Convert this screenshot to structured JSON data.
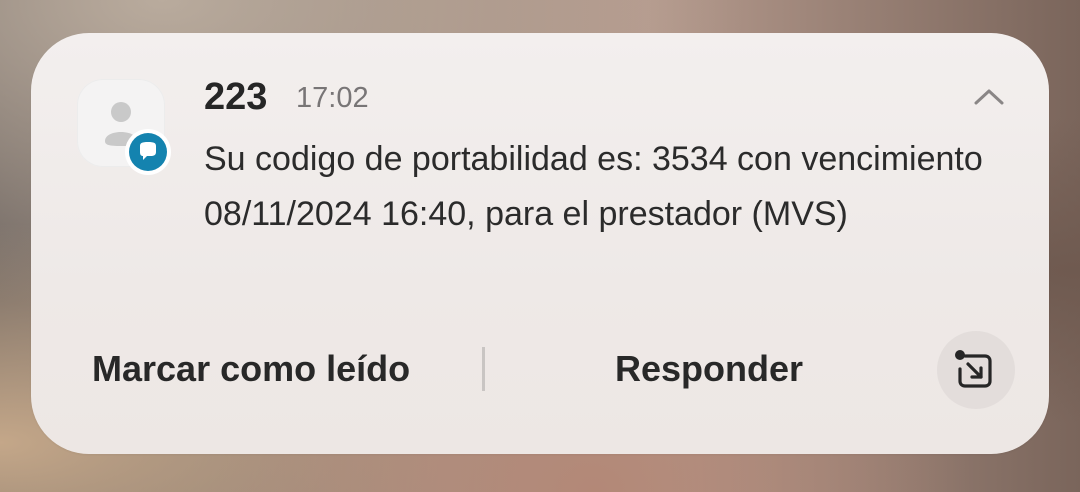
{
  "notification": {
    "sender": "223",
    "time": "17:02",
    "message": "Su codigo de portabilidad es: 3534 con vencimiento 08/11/2024 16:40, para el prestador (MVS)",
    "avatar_icon": "person-icon",
    "app_badge_icon": "message-bubble-icon",
    "collapse_icon": "chevron-up-icon",
    "colors": {
      "badge": "#1483af",
      "card": "#f0ebe9",
      "text": "#262626"
    }
  },
  "actions": {
    "mark_read_label": "Marcar como leído",
    "reply_label": "Responder",
    "expand_icon": "open-in-app-icon"
  }
}
